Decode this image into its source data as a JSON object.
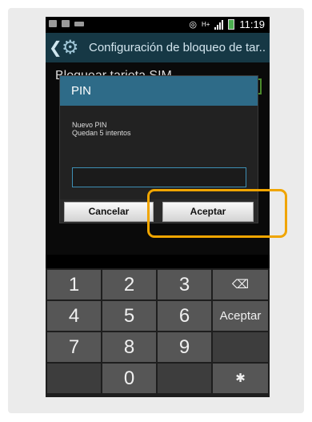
{
  "status_bar": {
    "time": "11:19",
    "network": "H+"
  },
  "action_bar": {
    "title": "Configuración de bloqueo de tar..",
    "back_glyph": "❮",
    "settings_glyph": "⚙"
  },
  "background": {
    "item_title": "Bloquear tarjeta SIM"
  },
  "dialog": {
    "title": "PIN",
    "line1": "Nuevo PIN",
    "line2": "Quedan 5 intentos",
    "pin_value": "",
    "cancel_label": "Cancelar",
    "accept_label": "Aceptar"
  },
  "keypad": {
    "row1": [
      "1",
      "2",
      "3"
    ],
    "row2": [
      "4",
      "5",
      "6"
    ],
    "row3": [
      "7",
      "8",
      "9"
    ],
    "row4": [
      "0"
    ],
    "backspace_glyph": "⌫",
    "enter_label": "Aceptar",
    "settings_glyph": "✱"
  },
  "colors": {
    "highlight": "#f0a500",
    "header": "#2e6b88",
    "action_bar": "#163845"
  }
}
